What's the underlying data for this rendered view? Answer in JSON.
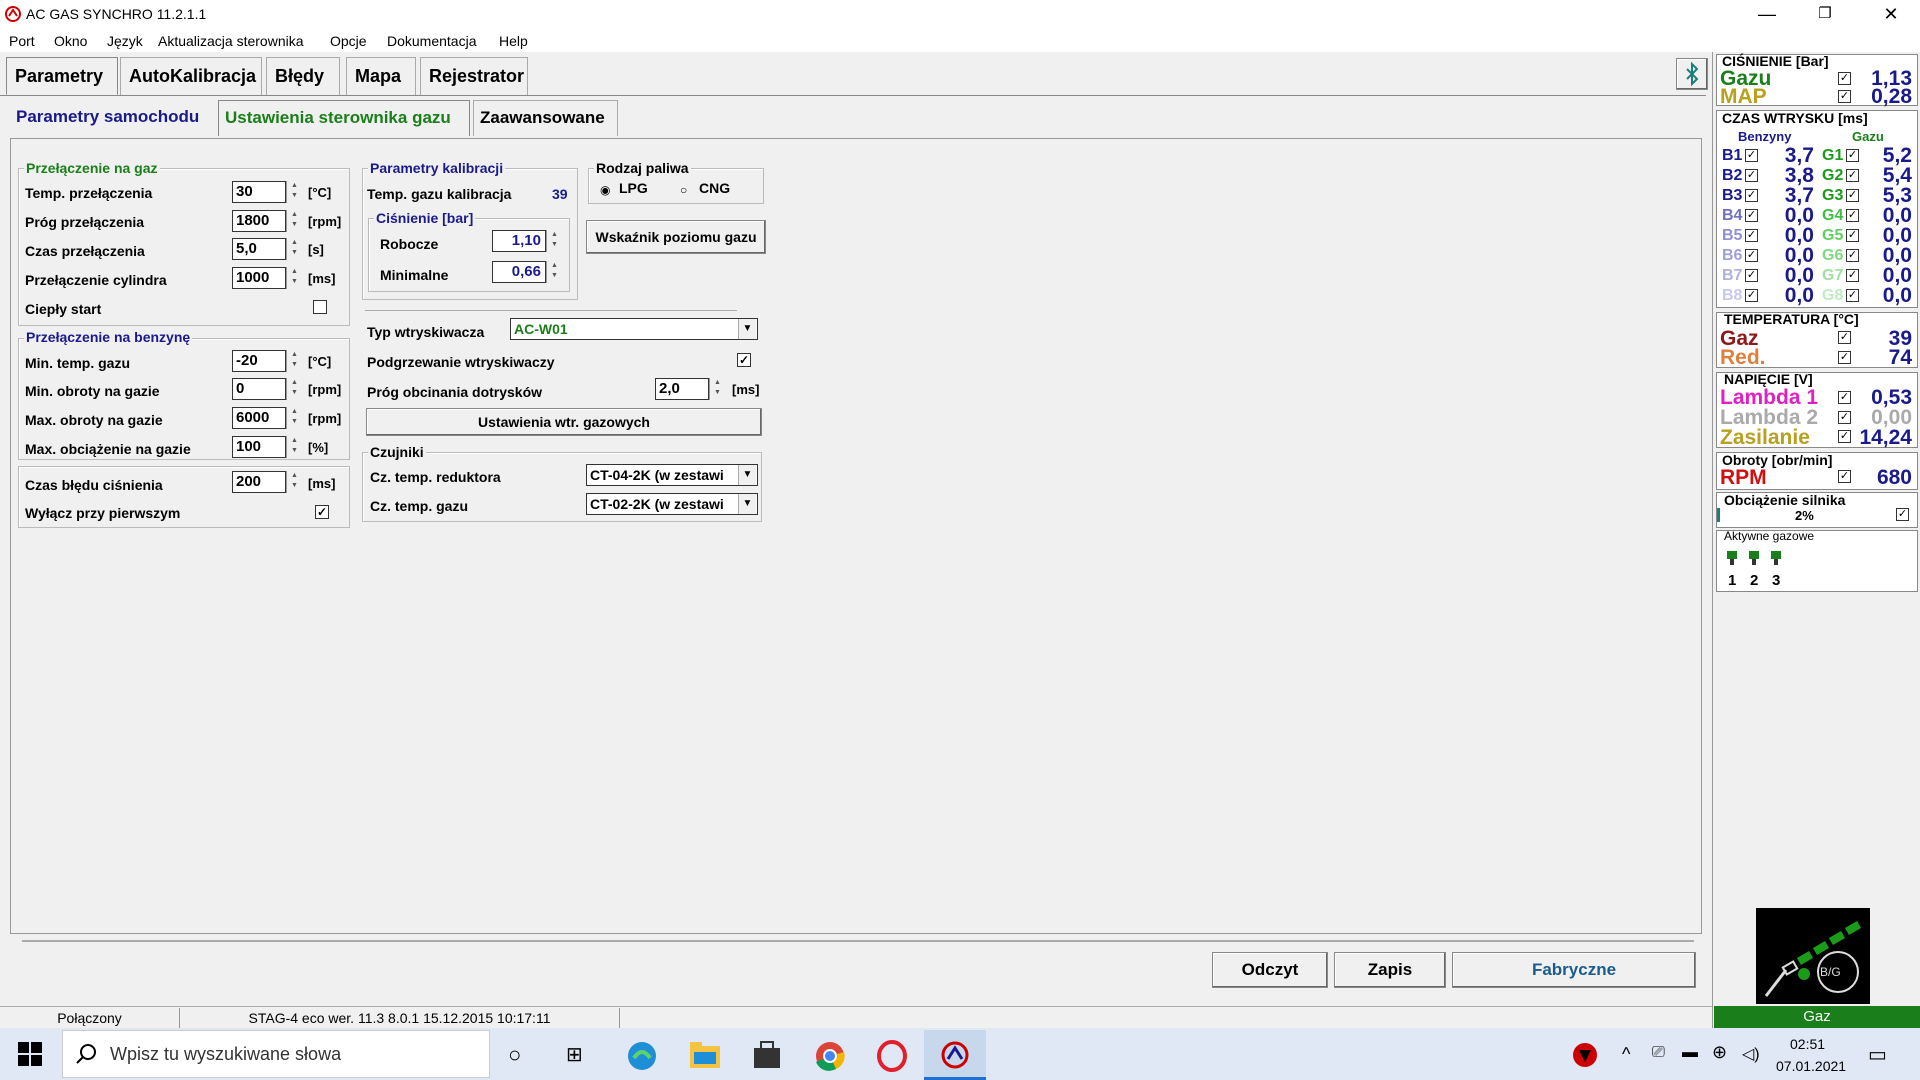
{
  "window": {
    "title": "AC GAS SYNCHRO  11.2.1.1",
    "min": "—",
    "restore": "❐",
    "close": "✕"
  },
  "menu": [
    "Port",
    "Okno",
    "Język",
    "Aktualizacja sterownika",
    "Opcje",
    "Dokumentacja",
    "Help"
  ],
  "tabs": [
    "Parametry",
    "AutoKalibracja",
    "Błędy",
    "Mapa",
    "Rejestrator"
  ],
  "subtabs": [
    "Parametry samochodu",
    "Ustawienia sterownika gazu",
    "Zaawansowane"
  ],
  "switch_to_gas": {
    "title": "Przełączenie na gaz",
    "rows": [
      {
        "label": "Temp. przełączenia",
        "value": "30",
        "unit": "[°C]"
      },
      {
        "label": "Próg przełączenia",
        "value": "1800",
        "unit": "[rpm]"
      },
      {
        "label": "Czas przełączenia",
        "value": "5,0",
        "unit": "[s]"
      },
      {
        "label": "Przełączenie cylindra",
        "value": "1000",
        "unit": "[ms]"
      }
    ],
    "warm_start": "Ciepły start"
  },
  "switch_to_petrol": {
    "title": "Przełączenie na benzynę",
    "rows": [
      {
        "label": "Min. temp. gazu",
        "value": "-20",
        "unit": "[°C]"
      },
      {
        "label": "Min. obroty na gazie",
        "value": "0",
        "unit": "[rpm]"
      },
      {
        "label": "Max. obroty na gazie",
        "value": "6000",
        "unit": "[rpm]"
      },
      {
        "label": "Max. obciążenie na gazie",
        "value": "100",
        "unit": "[%]"
      }
    ]
  },
  "pressure_error": {
    "label": "Czas błędu ciśnienia",
    "value": "200",
    "unit": "[ms]",
    "disable_first": "Wyłącz przy pierwszym"
  },
  "calibration": {
    "title": "Parametry kalibracji",
    "temp_label": "Temp. gazu kalibracja",
    "temp_value": "39",
    "pressure_title": "Ciśnienie [bar]",
    "working_label": "Robocze",
    "working_value": "1,10",
    "min_label": "Minimalne",
    "min_value": "0,66"
  },
  "fuel": {
    "title": "Rodzaj paliwa",
    "lpg": "LPG",
    "cng": "CNG",
    "level_button": "Wskaźnik poziomu gazu"
  },
  "injector": {
    "type_label": "Typ wtryskiwacza",
    "type_value": "AC-W01",
    "heating_label": "Podgrzewanie wtryskiwaczy",
    "cutoff_label": "Próg obcinania dotrysków",
    "cutoff_value": "2,0",
    "cutoff_unit": "[ms]",
    "settings_button": "Ustawienia wtr. gazowych"
  },
  "sensors": {
    "title": "Czujniki",
    "reducer_label": "Cz. temp. reduktora",
    "reducer_value": "CT-04-2K (w zestawi",
    "gas_label": "Cz. temp. gazu",
    "gas_value": "CT-02-2K (w zestawi"
  },
  "bottom_buttons": {
    "read": "Odczyt",
    "write": "Zapis",
    "factory": "Fabryczne"
  },
  "status": {
    "connected": "Połączony",
    "device": "STAG-4 eco   wer. 11.3  8.0.1    15.12.2015 10:17:11"
  },
  "right_panel": {
    "pressure_head": "CIŚNIENIE [Bar]",
    "gas_label": "Gazu",
    "gas_value": "1,13",
    "map_label": "MAP",
    "map_value": "0,28",
    "inj_head": "CZAS WTRYSKU  [ms]",
    "petrol_head": "Benzyny",
    "gas_head": "Gazu",
    "injectors": [
      {
        "b": "B1",
        "bv": "3,7",
        "g": "G1",
        "gv": "5,2"
      },
      {
        "b": "B2",
        "bv": "3,8",
        "g": "G2",
        "gv": "5,4"
      },
      {
        "b": "B3",
        "bv": "3,7",
        "g": "G3",
        "gv": "5,3"
      },
      {
        "b": "B4",
        "bv": "0,0",
        "g": "G4",
        "gv": "0,0"
      },
      {
        "b": "B5",
        "bv": "0,0",
        "g": "G5",
        "gv": "0,0"
      },
      {
        "b": "B6",
        "bv": "0,0",
        "g": "G6",
        "gv": "0,0"
      },
      {
        "b": "B7",
        "bv": "0,0",
        "g": "G7",
        "gv": "0,0"
      },
      {
        "b": "B8",
        "bv": "0,0",
        "g": "G8",
        "gv": "0,0"
      }
    ],
    "temp_head": "TEMPERATURA  [°C]",
    "temp_gas_label": "Gaz",
    "temp_gas_value": "39",
    "temp_red_label": "Red.",
    "temp_red_value": "74",
    "volt_head": "NAPIĘCIE [V]",
    "lambda1_label": "Lambda 1",
    "lambda1_value": "0,53",
    "lambda2_label": "Lambda 2",
    "lambda2_value": "0,00",
    "supply_label": "Zasilanie",
    "supply_value": "14,24",
    "rpm_head": "Obroty [obr/min]",
    "rpm_label": "RPM",
    "rpm_value": "680",
    "load_head": "Obciążenie silnika",
    "load_value": "2%",
    "active_head": "Aktywne gazowe",
    "active_nums": [
      "1",
      "2",
      "3"
    ],
    "bg_label": "B/G",
    "gas_status": "Gaz"
  },
  "taskbar": {
    "search_placeholder": "Wpisz tu wyszukiwane słowa",
    "time": "02:51",
    "date": "07.01.2021"
  }
}
